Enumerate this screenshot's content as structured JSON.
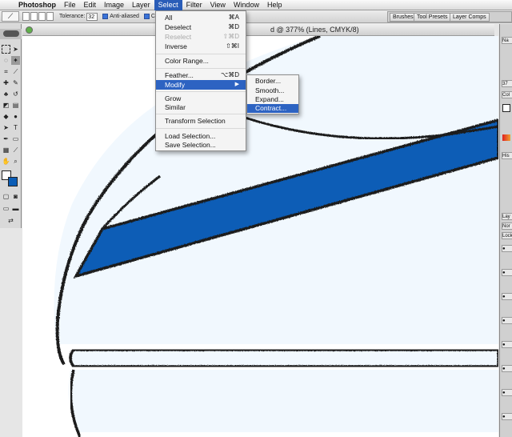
{
  "menubar": {
    "apple": "",
    "items": [
      "Photoshop",
      "File",
      "Edit",
      "Image",
      "Layer",
      "Select",
      "Filter",
      "View",
      "Window",
      "Help"
    ],
    "active": "Select"
  },
  "options_bar": {
    "tolerance_label": "Tolerance:",
    "tolerance_value": "32",
    "anti_aliased_label": "Anti-aliased",
    "contiguous_label": "Co",
    "tabs": [
      "Brushes",
      "Tool Presets",
      "Layer Comps"
    ]
  },
  "document": {
    "title": "d @ 377% (Lines, CMYK/8)"
  },
  "select_menu": {
    "all": {
      "label": "All",
      "shortcut": "⌘A"
    },
    "deselect": {
      "label": "Deselect",
      "shortcut": "⌘D"
    },
    "reselect": {
      "label": "Reselect",
      "shortcut": "⇧⌘D"
    },
    "inverse": {
      "label": "Inverse",
      "shortcut": "⇧⌘I"
    },
    "color_range": {
      "label": "Color Range..."
    },
    "feather": {
      "label": "Feather...",
      "shortcut": "⌥⌘D"
    },
    "modify": {
      "label": "Modify",
      "arrow": "▶"
    },
    "grow": {
      "label": "Grow"
    },
    "similar": {
      "label": "Similar"
    },
    "transform_selection": {
      "label": "Transform Selection"
    },
    "load_selection": {
      "label": "Load Selection..."
    },
    "save_selection": {
      "label": "Save Selection..."
    }
  },
  "modify_submenu": {
    "border": "Border...",
    "smooth": "Smooth...",
    "expand": "Expand...",
    "contract": "Contract..."
  },
  "dock": {
    "tabs": [
      "Na",
      "37",
      "Col",
      "His",
      "Lay",
      "Nor",
      "Lock"
    ]
  },
  "colors": {
    "selection_highlight": "#2d63c2",
    "stripe_blue": "#0b5db6",
    "fill_light": "#f1f8fe",
    "outline": "#1a1a1a"
  }
}
